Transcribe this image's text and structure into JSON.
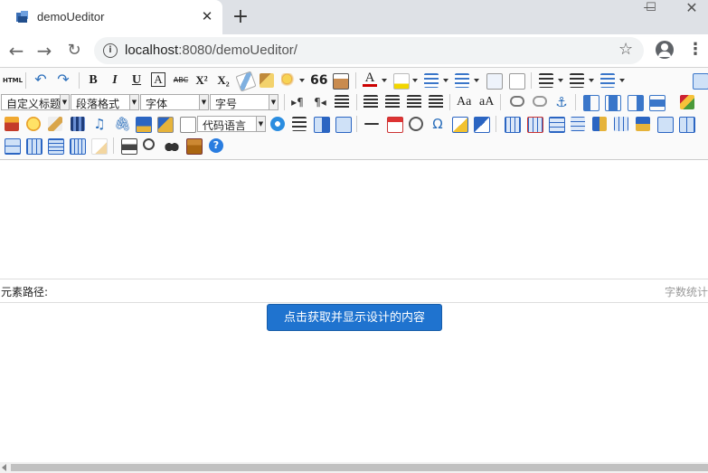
{
  "browser": {
    "tab_title": "demoUeditor",
    "tab_close": "✕",
    "new_tab": "+",
    "url_host": "localhost",
    "url_rest": ":8080/demoUeditor/",
    "window_min": "—",
    "window_max": "☐",
    "bookmark_icon": "☆"
  },
  "editor": {
    "row1_text_buttons": {
      "html": "HTML",
      "bold": "B",
      "italic": "I",
      "underline": "U",
      "fontborder": "A",
      "strikethrough": "ABC",
      "superscript": "X²",
      "subscript": "X₂",
      "blockquote": "66",
      "forecolor": "A"
    },
    "combos": {
      "custom_style": "自定义标题",
      "paragraph": "段落格式",
      "font_family": "字体",
      "font_size": "字号",
      "code_language": "代码语言"
    },
    "special_chars": "Ω"
  },
  "status": {
    "element_path": "元素路径:",
    "word_count": "字数统计"
  },
  "action_button": "点击获取并显示设计的内容"
}
